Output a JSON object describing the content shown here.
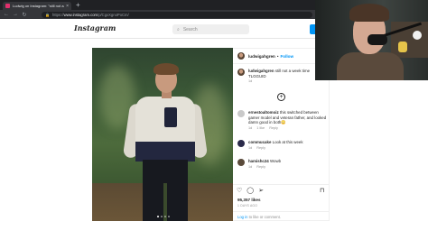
{
  "browser": {
    "tab_title": "Ludwig on Instagram: \"still not a...",
    "tab_close": "×",
    "new_tab": "+",
    "nav_back": "←",
    "nav_forward": "→",
    "nav_reload": "↻",
    "url_prefix": "https://",
    "url_host": "www.instagram.com",
    "url_path": "/p/CgxXgnoPoCm/"
  },
  "instagram": {
    "logo": "Instagram",
    "search_placeholder": "Search",
    "search_icon": "⌕"
  },
  "post": {
    "username": "ludwigahgren",
    "separator": "•",
    "follow_label": "Follow",
    "caption_user": "ludwigahgren",
    "caption_text": "still not a week time",
    "caption_link": "TLGGUID",
    "caption_age": "1d",
    "add_icon": "+",
    "comments": [
      {
        "user": "ernestoaltomoiz",
        "text": "this switched between gamer model and veteran father, and looked damn good in both😳",
        "age": "1d",
        "likes": "1 like",
        "reply": "Reply"
      },
      {
        "user": "commucake",
        "text": "Look at this week",
        "age": "1d",
        "reply": "Reply"
      },
      {
        "user": "hamishc24",
        "text": "Wowb",
        "age": "1d",
        "reply": "Reply"
      }
    ],
    "like_icon": "♡",
    "comment_icon": "◯",
    "share_icon": "➢",
    "bookmark_icon": "⊓",
    "likes": "95,357 likes",
    "date": "1 DAYS AGO",
    "login_link": "Log in",
    "login_suffix": "to like or comment.",
    "next_icon": "›"
  }
}
